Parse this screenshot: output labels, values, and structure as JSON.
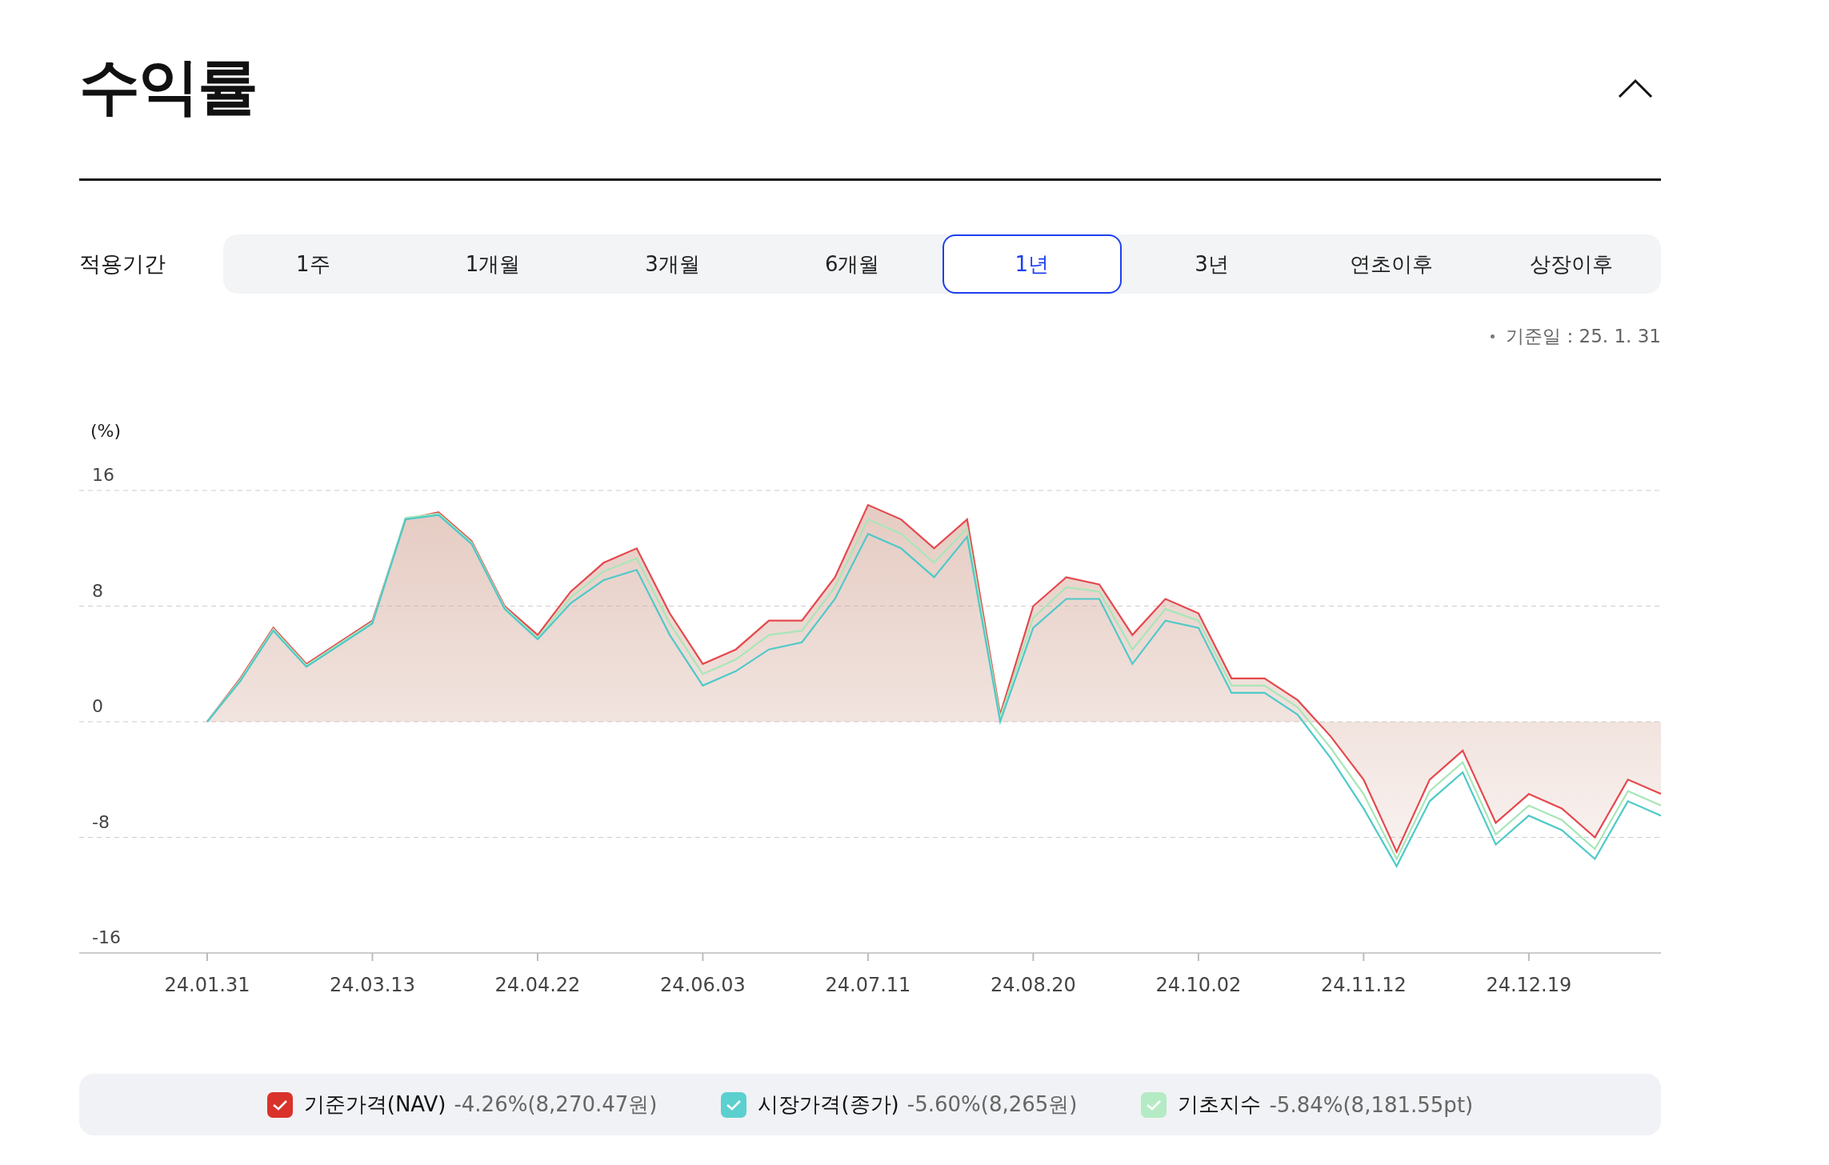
{
  "title": "수익률",
  "collapse": {
    "expanded": true
  },
  "period": {
    "label": "적용기간",
    "tabs": [
      {
        "label": "1주",
        "selected": false
      },
      {
        "label": "1개월",
        "selected": false
      },
      {
        "label": "3개월",
        "selected": false
      },
      {
        "label": "6개월",
        "selected": false
      },
      {
        "label": "1년",
        "selected": true
      },
      {
        "label": "3년",
        "selected": false
      },
      {
        "label": "연초이후",
        "selected": false
      },
      {
        "label": "상장이후",
        "selected": false
      }
    ]
  },
  "base_date": "기준일 : 25. 1. 31",
  "chart": {
    "chart_data": {
      "type": "line",
      "ylabel": "(%)",
      "grid": true,
      "categories": [
        "24.01.31",
        null,
        null,
        null,
        null,
        "24.03.13",
        null,
        null,
        null,
        null,
        "24.04.22",
        null,
        null,
        null,
        null,
        "24.06.03",
        null,
        null,
        null,
        null,
        "24.07.11",
        null,
        null,
        null,
        null,
        "24.08.20",
        null,
        null,
        null,
        null,
        "24.10.02",
        null,
        null,
        null,
        null,
        "24.11.12",
        null,
        null,
        null,
        null,
        "24.12.19",
        null,
        null,
        null,
        null
      ],
      "series": [
        {
          "type": "area",
          "color": "#e5484d",
          "values": [
            0,
            3,
            6.5,
            4,
            5.5,
            7,
            14,
            14.5,
            12.5,
            8,
            6,
            9,
            11,
            12,
            7.5,
            4,
            5,
            7,
            7,
            10,
            15,
            14,
            12,
            14,
            0.5,
            8,
            10,
            9.5,
            6,
            8.5,
            7.5,
            3,
            3,
            1.5,
            -1,
            -4,
            -9,
            -4,
            -2,
            -7,
            -5,
            -6,
            -8,
            -4,
            -5
          ]
        },
        {
          "type": "line",
          "color": "#4fc9c9",
          "values": [
            0,
            2.8,
            6.3,
            3.8,
            5.3,
            6.8,
            14,
            14.3,
            12.3,
            7.8,
            5.7,
            8.2,
            9.8,
            10.5,
            6,
            2.5,
            3.5,
            5,
            5.5,
            8.5,
            13,
            12,
            10,
            12.8,
            0,
            6.5,
            8.5,
            8.5,
            4,
            7,
            6.5,
            2,
            2,
            0.5,
            -2.5,
            -6,
            -10,
            -5.5,
            -3.5,
            -8.5,
            -6.5,
            -7.5,
            -9.5,
            -5.5,
            -6.5
          ]
        },
        {
          "type": "line",
          "color": "#a8e6b8",
          "values": [
            0,
            2.9,
            6.4,
            3.9,
            5.4,
            6.9,
            14.1,
            14.4,
            12.4,
            7.9,
            5.8,
            8.6,
            10.4,
            11.3,
            6.8,
            3.3,
            4.3,
            6,
            6.3,
            9.3,
            14,
            13,
            11,
            13.4,
            0.3,
            7.2,
            9.3,
            9,
            5,
            7.8,
            7,
            2.5,
            2.5,
            1,
            -1.8,
            -5,
            -9.5,
            -4.8,
            -2.8,
            -7.8,
            -5.8,
            -6.8,
            -8.8,
            -4.8,
            -5.8
          ]
        }
      ],
      "ylim": [
        -16,
        16
      ],
      "yticks": [
        16,
        8,
        0,
        -8,
        -16
      ]
    }
  },
  "legend": [
    {
      "name": "기준가격(NAV)",
      "value": "-4.26%(8,270.47원)",
      "checked": true,
      "color": "#d9322b"
    },
    {
      "name": "시장가격(종가)",
      "value": "-5.60%(8,265원)",
      "checked": true,
      "color": "#5ccfcf"
    },
    {
      "name": "기초지수",
      "value": "-5.84%(8,181.55pt)",
      "checked": true,
      "color": "#b5ebc4"
    }
  ]
}
